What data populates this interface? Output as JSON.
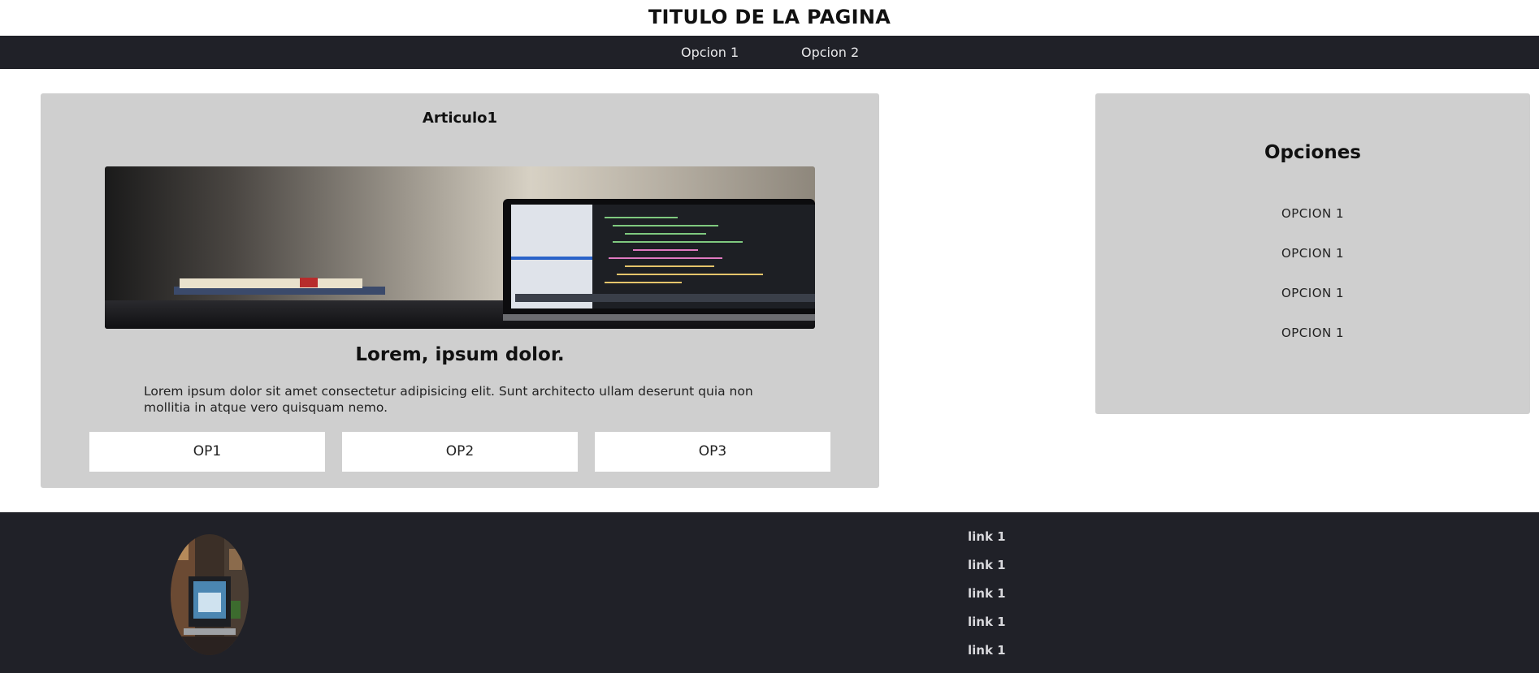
{
  "header": {
    "title": "TITULO DE LA PAGINA"
  },
  "nav": {
    "items": [
      {
        "label": "Opcion 1"
      },
      {
        "label": "Opcion 2"
      }
    ]
  },
  "article": {
    "title": "Articulo1",
    "image_alt": "laptop with code on a desk",
    "heading": "Lorem, ipsum dolor.",
    "text": "Lorem ipsum dolor sit amet consectetur adipisicing elit. Sunt architecto ullam deserunt quia non mollitia in atque vero quisquam nemo.",
    "buttons": [
      {
        "label": "OP1"
      },
      {
        "label": "OP2"
      },
      {
        "label": "OP3"
      }
    ]
  },
  "sidebar": {
    "title": "Opciones",
    "items": [
      {
        "label": "OPCION 1"
      },
      {
        "label": "OPCION 1"
      },
      {
        "label": "OPCION 1"
      },
      {
        "label": "OPCION 1"
      }
    ]
  },
  "footer": {
    "links": [
      {
        "label": "link 1"
      },
      {
        "label": "link 1"
      },
      {
        "label": "link 1"
      },
      {
        "label": "link 1"
      },
      {
        "label": "link 1"
      }
    ]
  },
  "colors": {
    "dark_bar": "#202128",
    "panel": "#cfcfcf",
    "background": "#ffffff"
  }
}
